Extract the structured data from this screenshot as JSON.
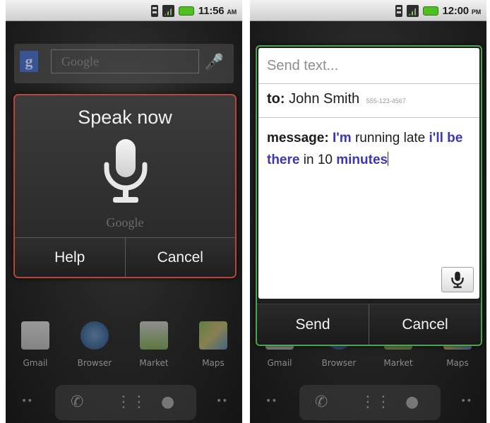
{
  "left_screen": {
    "status": {
      "time": "11:56",
      "ampm": "AM"
    },
    "home_search": {
      "logo": "g",
      "placeholder": "Google"
    },
    "voice_dialog": {
      "title": "Speak now",
      "brand": "Google",
      "help_label": "Help",
      "cancel_label": "Cancel",
      "border_color": "#b5473a"
    },
    "apps": [
      {
        "label": "Gmail",
        "icon": "gmail-icon"
      },
      {
        "label": "Browser",
        "icon": "globe-icon"
      },
      {
        "label": "Market",
        "icon": "market-icon"
      },
      {
        "label": "Maps",
        "icon": "maps-icon"
      }
    ]
  },
  "right_screen": {
    "status": {
      "time": "12:00",
      "ampm": "PM"
    },
    "send_dialog": {
      "title": "Send text...",
      "to_label": "to:",
      "recipient": "John Smith",
      "number": "555-123-4567",
      "message_label": "message:",
      "message_parts": [
        {
          "text": "I'm",
          "highlight": true
        },
        {
          "text": "running late",
          "highlight": false
        },
        {
          "text": "i'll be there",
          "highlight": true
        },
        {
          "text": "in 10",
          "highlight": false
        },
        {
          "text": "minutes",
          "highlight": true
        }
      ],
      "send_label": "Send",
      "cancel_label": "Cancel",
      "border_color": "#4fa34f",
      "highlight_color": "#3b36b8"
    },
    "apps": [
      {
        "label": "Gmail",
        "icon": "gmail-icon"
      },
      {
        "label": "Browser",
        "icon": "globe-icon"
      },
      {
        "label": "Market",
        "icon": "market-icon"
      },
      {
        "label": "Maps",
        "icon": "maps-icon"
      }
    ]
  }
}
